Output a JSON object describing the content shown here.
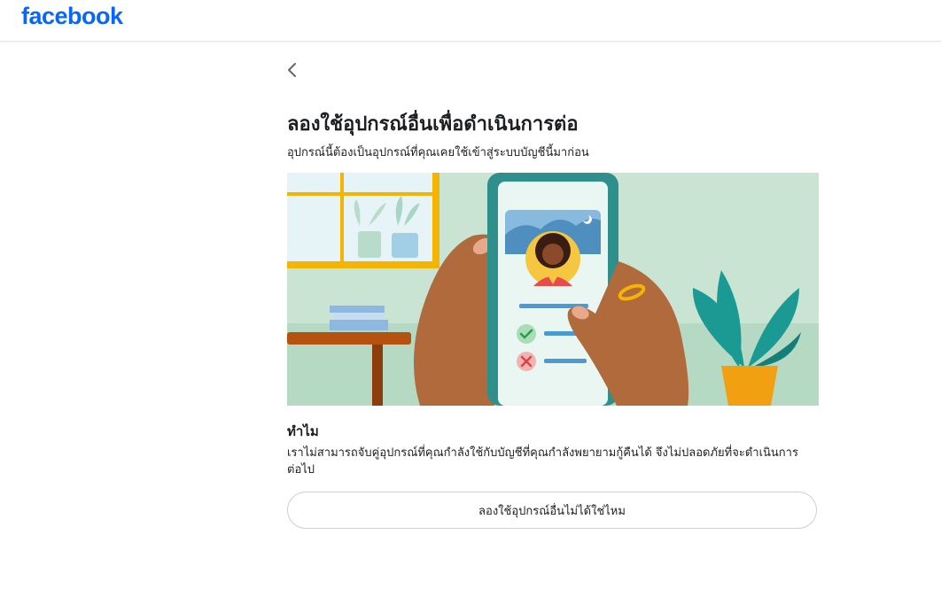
{
  "header": {
    "logo_text": "facebook",
    "brand_color": "#0866ff"
  },
  "nav": {
    "back_icon": "chevron-left-icon"
  },
  "main": {
    "title": "ลองใช้อุปกรณ์อื่นเพื่อดำเนินการต่อ",
    "subtitle": "อุปกรณ์นี้ต้องเป็นอุปกรณ์ที่คุณเคยใช้เข้าสู่ระบบบัญชีนี้มาก่อน",
    "why_heading": "ทำไม",
    "why_body": "เราไม่สามารถจับคู่อุปกรณ์ที่คุณกำลังใช้กับบัญชีที่คุณกำลังพยายามกู้คืนได้ จึงไม่ปลอดภัยที่จะดำเนินการต่อไป",
    "alt_button_label": "ลองใช้อุปกรณ์อื่นไม่ได้ใช่ไหม"
  },
  "illustration": {
    "subject": "hands-holding-phone-with-profile-verification",
    "colors": {
      "background": "#c9e4d3",
      "phone": "#2f8f8a",
      "screen": "#e9f6f1",
      "skin": "#b06a3b",
      "window_frame": "#f5b400",
      "plant": "#1a9a92",
      "pot": "#f0a010",
      "table": "#b5520f"
    }
  }
}
